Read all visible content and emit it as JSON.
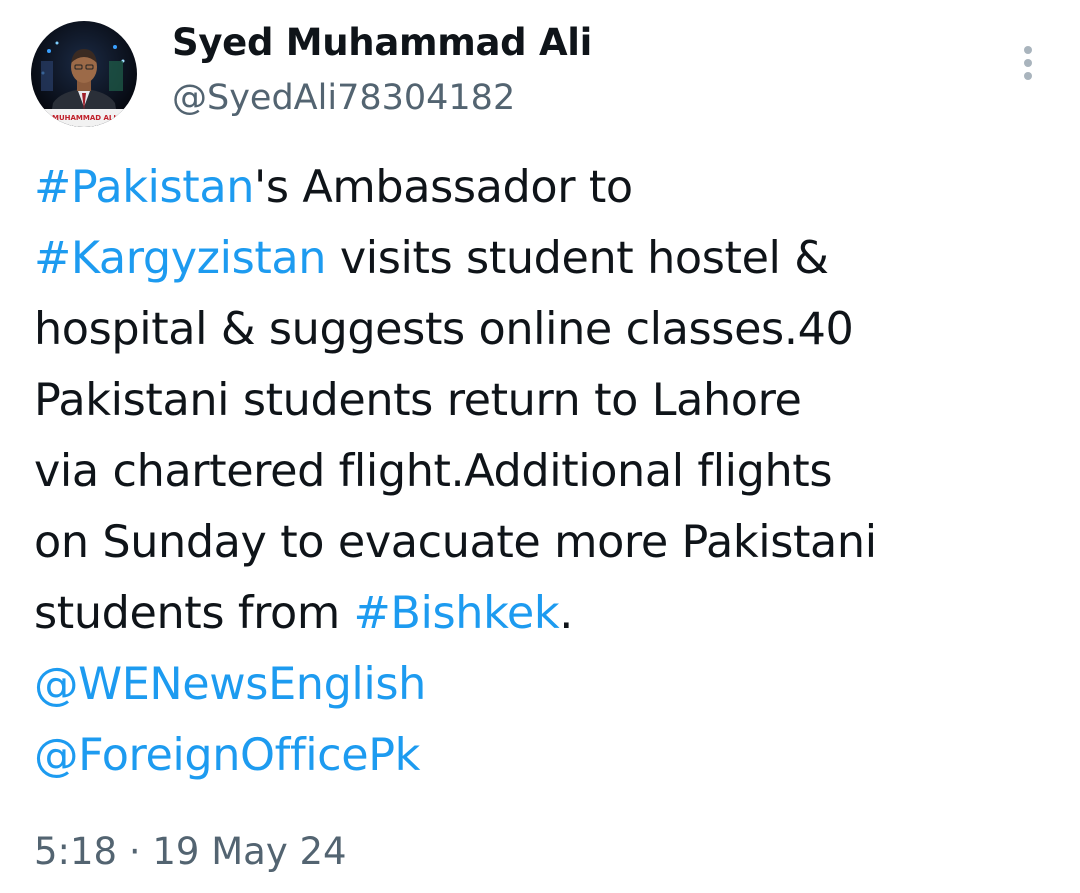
{
  "colors": {
    "link": "#1d9bf0",
    "text": "#0f1419",
    "secondary": "#536471",
    "more_dots": "#a9b4bd"
  },
  "author": {
    "display_name": "Syed Muhammad Ali",
    "handle": "@SyedAli78304182",
    "avatar_caption": "MUHAMMAD ALI"
  },
  "more_icon": "more-vertical-icon",
  "tweet": {
    "parts": {
      "hashtag_pakistan": "#Pakistan",
      "after_pakistan": "'s Ambassador to",
      "hashtag_kargyzistan": "#Kargyzistan",
      "after_kargyzistan": " visits student hostel &",
      "line3": "hospital & suggests online classes.40",
      "line4": "Pakistani students return to Lahore",
      "line5": "via chartered flight.Additional flights",
      "line6": "on Sunday to evacuate more Pakistani",
      "before_bishkek": "students from ",
      "hashtag_bishkek": "#Bishkek",
      "after_bishkek": ".",
      "mention_wenews": "@WENewsEnglish",
      "mention_foreignoffice": "@ForeignOfficePk"
    }
  },
  "meta": {
    "time": "5:18",
    "separator": " · ",
    "date": "19 May 24"
  }
}
